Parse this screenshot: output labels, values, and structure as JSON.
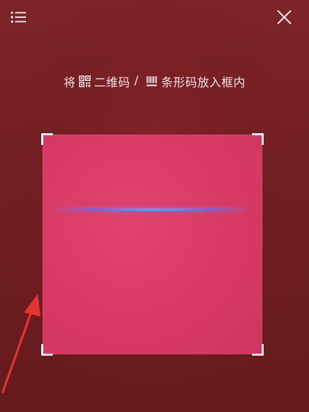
{
  "scanner": {
    "hint_before": "将",
    "hint_qr": "二维码",
    "hint_separator": "/",
    "hint_barcode": "条形码放入框内"
  },
  "icons": {
    "menu": "menu-icon",
    "close": "close-icon",
    "qr": "qr-code-icon",
    "barcode": "barcode-icon"
  },
  "colors": {
    "background": "#701e21",
    "scan_area": "#d83a66",
    "scan_line": "#5aa0f0",
    "annotation_arrow": "#e53333"
  }
}
